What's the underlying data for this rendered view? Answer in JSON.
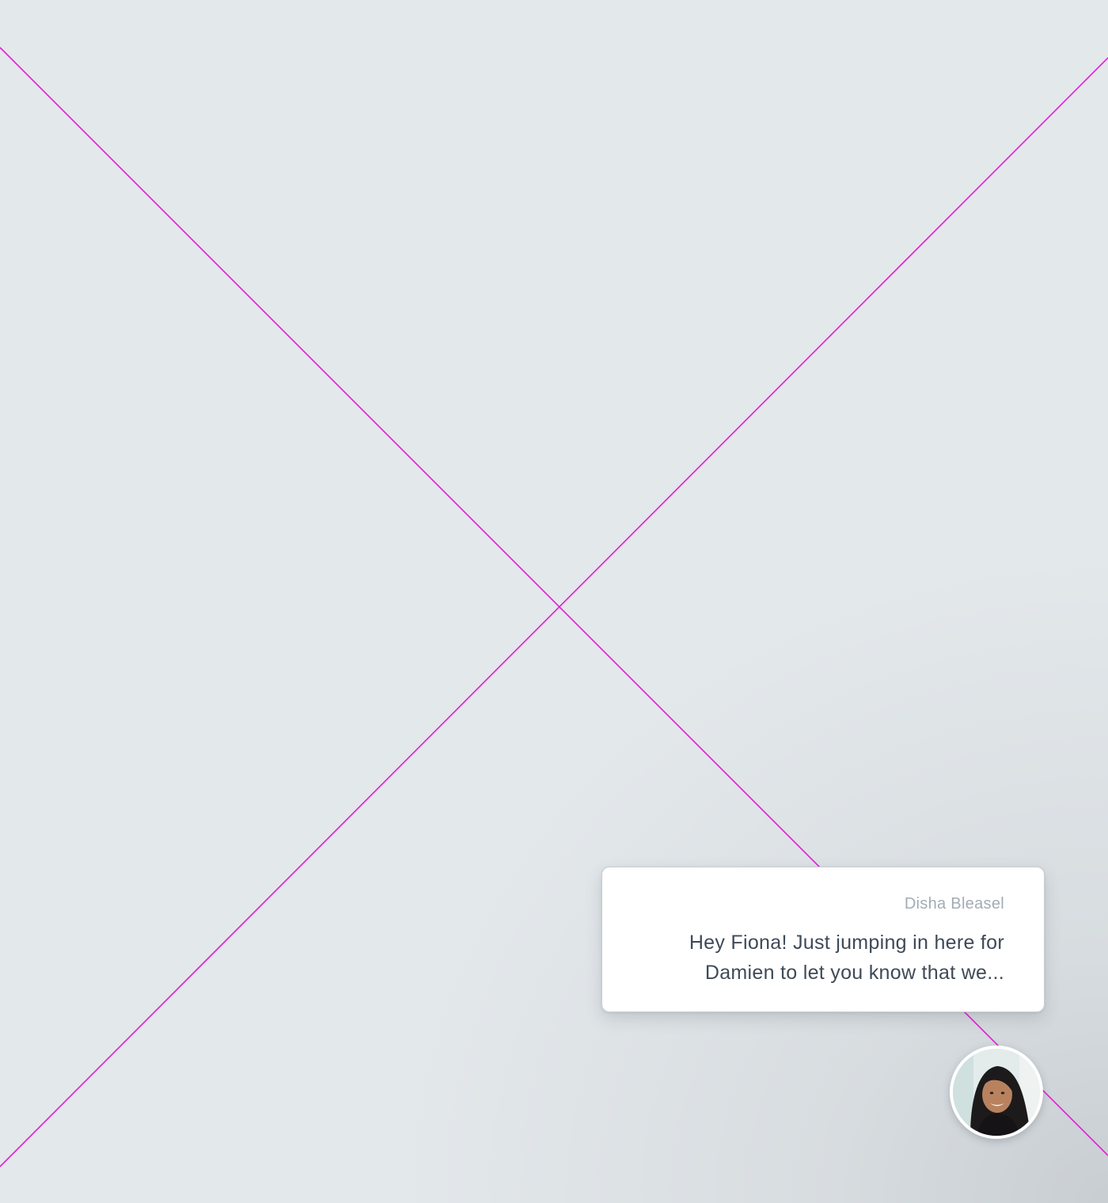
{
  "canvas": {
    "background": "#e3e8eb",
    "guide_color": "#e61ad8"
  },
  "message": {
    "sender": "Disha Bleasel",
    "preview": "Hey Fiona! Just jumping in here for Damien to let you know that we..."
  },
  "avatar": {
    "icon": "person-photo"
  }
}
